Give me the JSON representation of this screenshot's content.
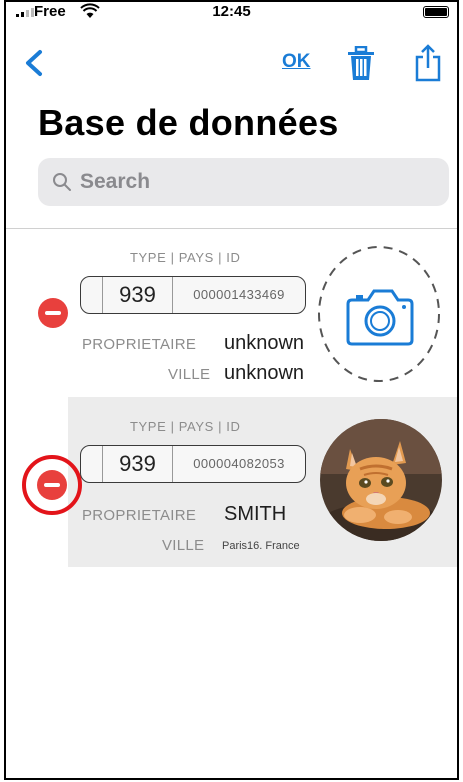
{
  "status_bar": {
    "carrier": "Free",
    "time": "12:45"
  },
  "nav": {
    "ok_label": "OK"
  },
  "page_title": "Base de données",
  "search": {
    "placeholder": "Search"
  },
  "records": [
    {
      "header": "TYPE | PAYS | ID",
      "pays": "939",
      "id": "000001433469",
      "owner_label": "PROPRIETAIRE",
      "owner": "unknown",
      "city_label": "VILLE",
      "city": "unknown",
      "photo": "camera-icon"
    },
    {
      "header": "TYPE | PAYS | ID",
      "pays": "939",
      "id": "000004082053",
      "owner_label": "PROPRIETAIRE",
      "owner": "SMITH",
      "city_label": "VILLE",
      "city": "Paris16. France",
      "photo": "kitten-photo"
    }
  ],
  "colors": {
    "accent": "#1a7cd6",
    "delete": "#e8403d",
    "highlight": "#e3141a"
  }
}
